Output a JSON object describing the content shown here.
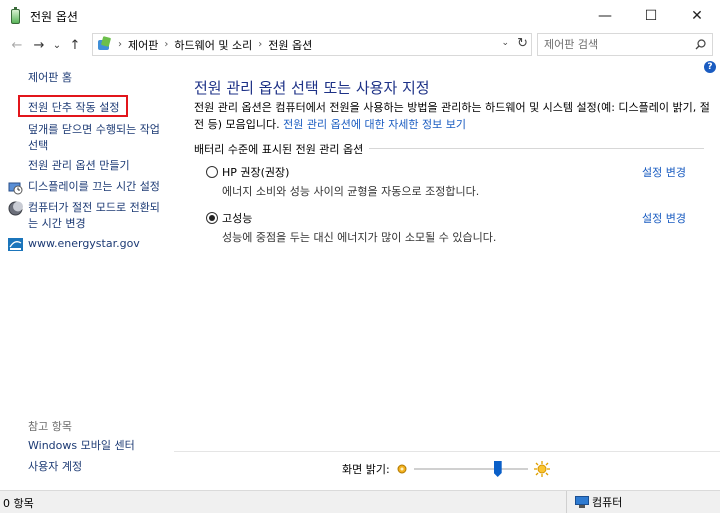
{
  "window": {
    "title": "전원 옵션",
    "minimize_glyph": "—",
    "maximize_glyph": "☐",
    "close_glyph": "✕"
  },
  "nav": {
    "back_glyph": "←",
    "forward_glyph": "→",
    "recent_glyph": "⌄",
    "up_glyph": "↑"
  },
  "address": {
    "breadcrumbs": [
      "제어판",
      "하드웨어 및 소리",
      "전원 옵션"
    ],
    "separator": "›",
    "dropdown_glyph": "⌄",
    "refresh_glyph": "↻"
  },
  "search": {
    "placeholder": "제어판 검색",
    "icon": "search-icon"
  },
  "sidebar": {
    "home": "제어판 홈",
    "tasks": [
      {
        "label": "전원 단추 작동 설정",
        "highlighted": true
      },
      {
        "label": "덮개를 닫으면 수행되는 작업 선택"
      },
      {
        "label": "전원 관리 옵션 만들기"
      }
    ],
    "icon_links": [
      {
        "label": "디스플레이를 끄는 시간 설정",
        "icon": "display-clock-icon"
      },
      {
        "label": "컴퓨터가 절전 모드로 전환되는 시간 변경",
        "icon": "sleep-moon-icon"
      },
      {
        "label": "www.energystar.gov",
        "icon": "energystar-icon"
      }
    ],
    "see_also": "참고 항목",
    "see_also_links": [
      "Windows 모바일 센터",
      "사용자 계정"
    ]
  },
  "main": {
    "title": "전원 관리 옵션 선택 또는 사용자 지정",
    "description": "전원 관리 옵션은 컴퓨터에서 전원을 사용하는 방법을 관리하는 하드웨어 및 시스템 설정(예: 디스플레이 밝기, 절전 등) 모음입니다.",
    "description_link": "전원 관리 옵션에 대한 자세한 정보 보기",
    "group_label": "배터리 수준에 표시된 전원 관리 옵션",
    "plans": [
      {
        "name": "HP 권장(권장)",
        "description": "에너지 소비와 성능 사이의 균형을 자동으로 조정합니다.",
        "change_label": "설정 변경",
        "selected": false
      },
      {
        "name": "고성능",
        "description": "성능에 중점을 두는 대신 에너지가 많이 소모될 수 있습니다.",
        "change_label": "설정 변경",
        "selected": true
      }
    ],
    "brightness_label": "화면 밝기:",
    "brightness_level": 0.75,
    "help_glyph": "?"
  },
  "status": {
    "items_count": "0 항목",
    "location": "컴퓨터"
  },
  "colors": {
    "link": "#1a5cc1",
    "title": "#1e3287",
    "highlight_border": "#e2151b",
    "slider_thumb": "#0a5fc8"
  }
}
